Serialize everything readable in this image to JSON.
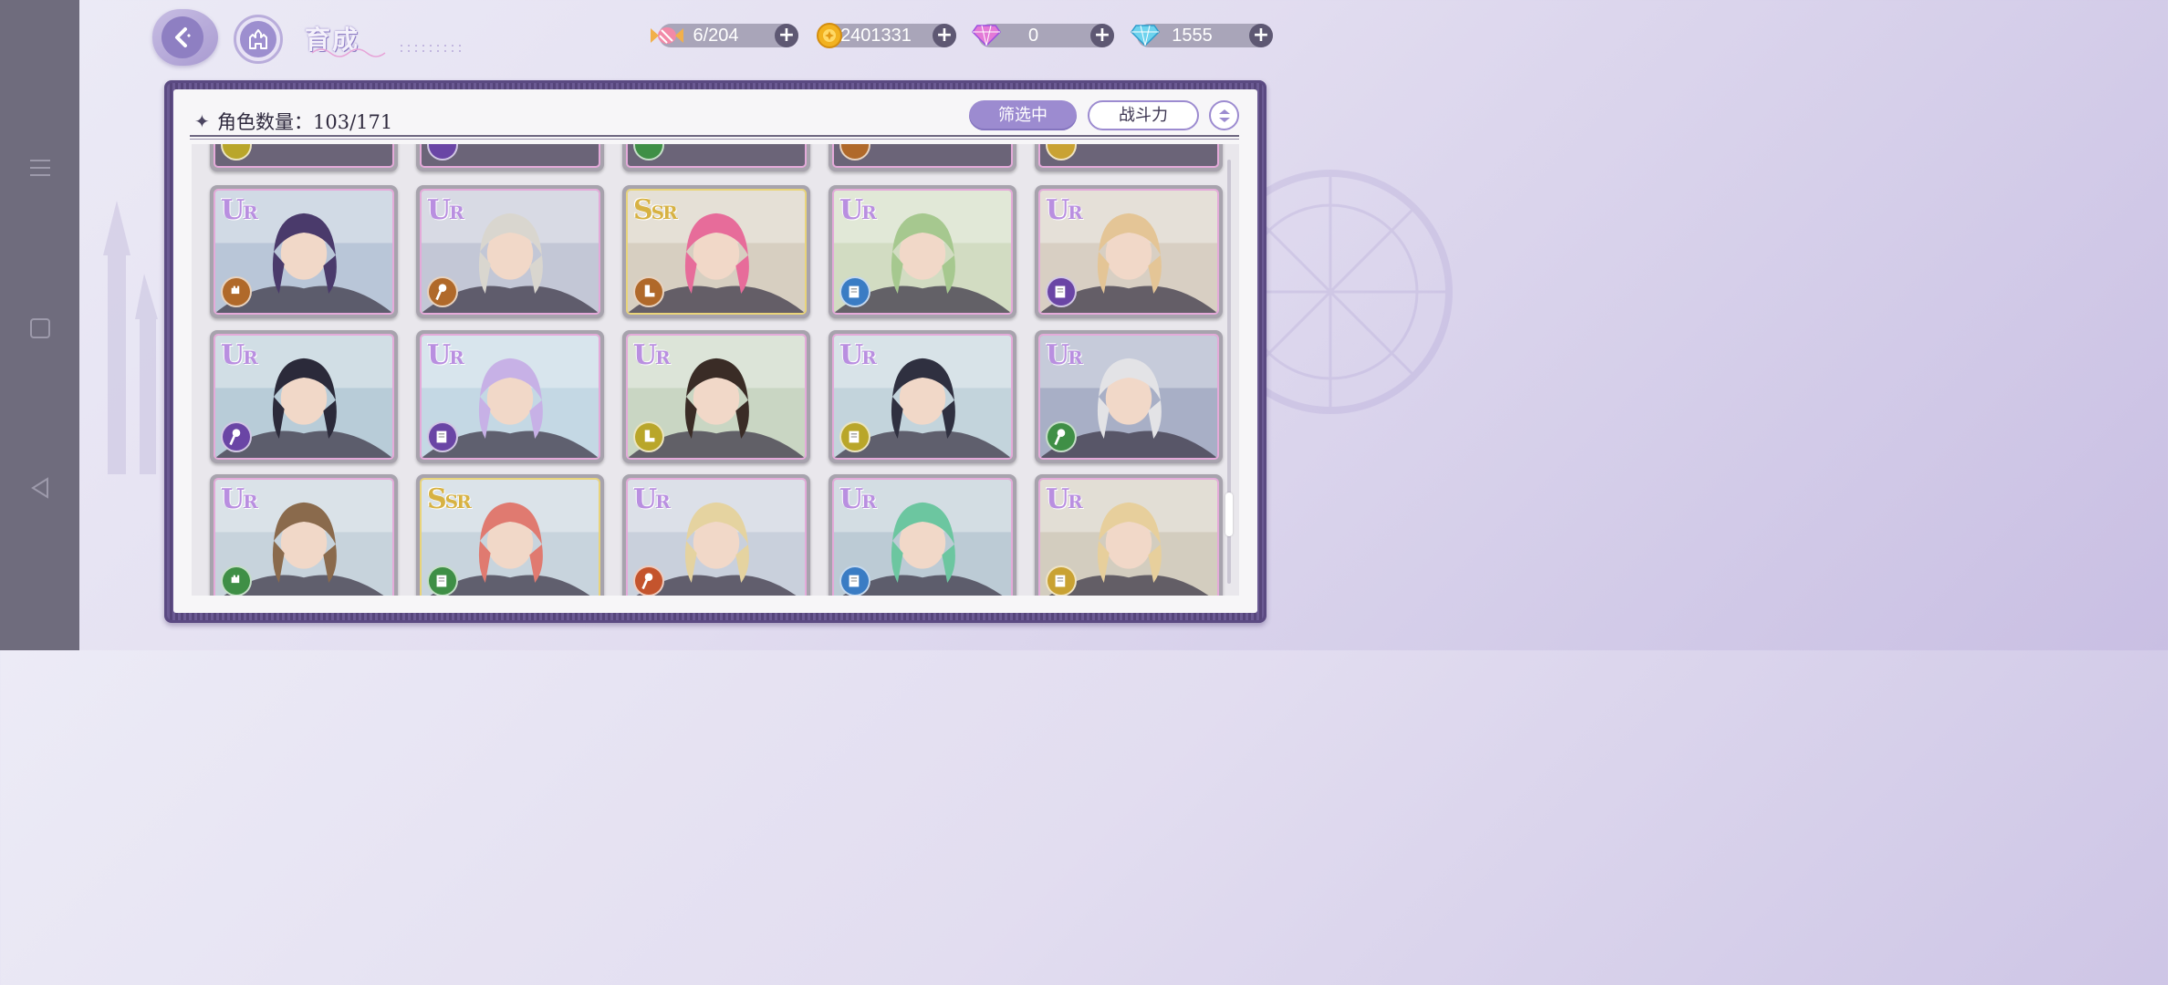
{
  "header": {
    "title": "育成",
    "back_icon": "back-arrow-icon",
    "home_icon": "castle-icon"
  },
  "resources": [
    {
      "name": "candy",
      "icon": "candy-icon",
      "value": "6/204"
    },
    {
      "name": "gold",
      "icon": "gold-coin-icon",
      "value": "2401331"
    },
    {
      "name": "pink-gem",
      "icon": "pink-diamond-icon",
      "value": "0"
    },
    {
      "name": "blue-gem",
      "icon": "blue-diamond-icon",
      "value": "1555"
    }
  ],
  "panel": {
    "count_label": "角色数量：103/171",
    "filter_label": "筛选中",
    "sort_label": "战斗力",
    "order_icon": "sort-order-icon"
  },
  "cards": [
    {
      "rarity": "UR",
      "class_icon": "fist-icon",
      "class_color": "#b0692a",
      "hair": "#4a3a6b",
      "bg": "#b9c6d8"
    },
    {
      "rarity": "UR",
      "class_icon": "staff-icon",
      "class_color": "#b0692a",
      "hair": "#d9d6cf",
      "bg": "#c3c7d6"
    },
    {
      "rarity": "SSR",
      "class_icon": "boot-icon",
      "class_color": "#b0692a",
      "hair": "#e76c9a",
      "bg": "#d7cfc1"
    },
    {
      "rarity": "UR",
      "class_icon": "book-icon",
      "class_color": "#3a7cc4",
      "hair": "#a6c88f",
      "bg": "#d2dcc2"
    },
    {
      "rarity": "UR",
      "class_icon": "book-icon",
      "class_color": "#6a45a5",
      "hair": "#e4c596",
      "bg": "#d8cfc3"
    },
    {
      "rarity": "UR",
      "class_icon": "staff-icon",
      "class_color": "#6a45a5",
      "hair": "#2b2a3a",
      "bg": "#b8ccd8"
    },
    {
      "rarity": "UR",
      "class_icon": "book-icon",
      "class_color": "#6a45a5",
      "hair": "#c7b1e6",
      "bg": "#c4d8e4"
    },
    {
      "rarity": "UR",
      "class_icon": "boot-icon",
      "class_color": "#b9a62a",
      "hair": "#3a2c26",
      "bg": "#c9d6c3"
    },
    {
      "rarity": "UR",
      "class_icon": "book-icon",
      "class_color": "#b9a62a",
      "hair": "#2f3040",
      "bg": "#c3d4dc"
    },
    {
      "rarity": "UR",
      "class_icon": "staff-icon",
      "class_color": "#3f8f46",
      "hair": "#e3e3e6",
      "bg": "#a8afc6"
    },
    {
      "rarity": "UR",
      "class_icon": "fist-icon",
      "class_color": "#3f8f46",
      "hair": "#8a6a4c",
      "bg": "#c7d3dc"
    },
    {
      "rarity": "SSR",
      "class_icon": "book-icon",
      "class_color": "#3f8f46",
      "hair": "#e07a70",
      "bg": "#c8d4dd"
    },
    {
      "rarity": "UR",
      "class_icon": "staff-icon",
      "class_color": "#c4542d",
      "hair": "#e5d3a0",
      "bg": "#c9d0dc"
    },
    {
      "rarity": "UR",
      "class_icon": "book-icon",
      "class_color": "#3a7cc4",
      "hair": "#6cc6a0",
      "bg": "#bccbd5"
    },
    {
      "rarity": "UR",
      "class_icon": "book-icon",
      "class_color": "#c9a233",
      "hair": "#e7cf9c",
      "bg": "#d3cdbf"
    }
  ],
  "top_row_icons": [
    {
      "class_color": "#b9a62a"
    },
    {
      "class_color": "#6a45a5"
    },
    {
      "class_color": "#3f8f46"
    },
    {
      "class_color": "#b0692a"
    },
    {
      "class_color": "#c9a233"
    }
  ]
}
